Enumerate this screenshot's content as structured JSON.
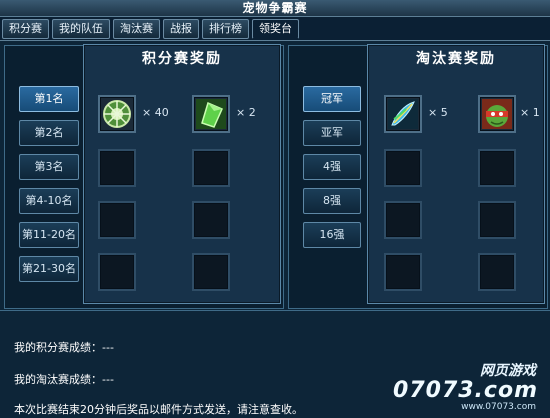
{
  "window": {
    "title": "宠物争霸赛"
  },
  "tabs": [
    {
      "label": "积分赛",
      "active": false
    },
    {
      "label": "我的队伍",
      "active": false
    },
    {
      "label": "淘汰赛",
      "active": false
    },
    {
      "label": "战报",
      "active": false
    },
    {
      "label": "排行榜",
      "active": false
    },
    {
      "label": "领奖台",
      "active": true
    }
  ],
  "points_rewards": {
    "title": "积分赛奖励",
    "ranks": [
      "第1名",
      "第2名",
      "第3名",
      "第4-10名",
      "第11-20名",
      "第21-30名"
    ],
    "selected_rank": "第1名",
    "items": [
      {
        "icon": "green-gear-orb-icon",
        "quantity": "× 40"
      },
      {
        "icon": "green-crystal-icon",
        "quantity": "× 2"
      }
    ]
  },
  "knockout_rewards": {
    "title": "淘汰赛奖励",
    "ranks": [
      "冠军",
      "亚军",
      "4强",
      "8强",
      "16强"
    ],
    "selected_rank": "冠军",
    "items": [
      {
        "icon": "feather-quill-icon",
        "quantity": "× 5"
      },
      {
        "icon": "ninja-turtle-avatar-icon",
        "quantity": "× 1"
      }
    ]
  },
  "info": {
    "points_result": "我的积分赛成绩：---",
    "knockout_result": "我的淘汰赛成绩：---",
    "notice": "本次比赛结束20分钟后奖品以邮件方式发送，请注意查收。"
  },
  "watermark": {
    "line1": "网页游戏",
    "line2": "07073.com",
    "line3": "www.07073.com"
  }
}
